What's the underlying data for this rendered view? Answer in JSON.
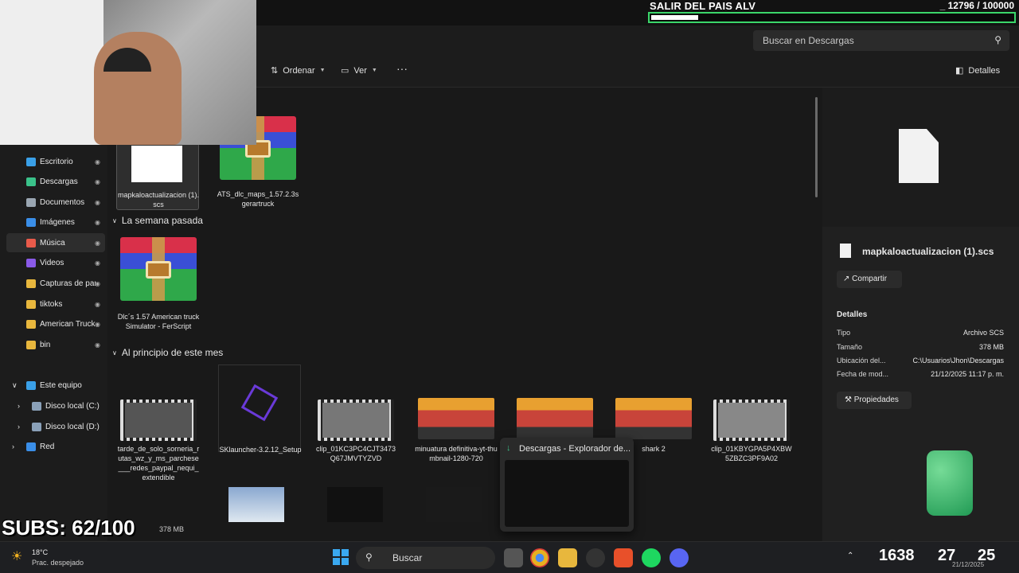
{
  "goal": {
    "title": "SALIR DEL PAIS ALV",
    "count": "_ 12796 / 100000",
    "progress": 0.128
  },
  "search": {
    "placeholder": "Buscar en Descargas"
  },
  "toolbar": {
    "sort": "Ordenar",
    "view": "Ver",
    "more": "···",
    "details": "Detalles"
  },
  "sidebar": {
    "quick": [
      {
        "label": "Escritorio",
        "icon": "desktop-icon",
        "color": "#3aa0e8"
      },
      {
        "label": "Descargas",
        "icon": "download-icon",
        "color": "#3ac28a"
      },
      {
        "label": "Documentos",
        "icon": "document-icon",
        "color": "#9aa6b2"
      },
      {
        "label": "Imágenes",
        "icon": "pictures-icon",
        "color": "#3a8ee8"
      },
      {
        "label": "Música",
        "icon": "music-icon",
        "color": "#e85a4a"
      },
      {
        "label": "Videos",
        "icon": "video-icon",
        "color": "#8a5ae8"
      },
      {
        "label": "Capturas de pan",
        "icon": "folder-icon",
        "color": "#e8b73d"
      },
      {
        "label": "tiktoks",
        "icon": "folder-icon",
        "color": "#e8b73d"
      },
      {
        "label": "American Truck",
        "icon": "folder-icon",
        "color": "#e8b73d"
      },
      {
        "label": "bin",
        "icon": "folder-icon",
        "color": "#e8b73d"
      }
    ],
    "tree": [
      {
        "label": "Este equipo"
      },
      {
        "label": "Disco local (C:)"
      },
      {
        "label": "Disco local (D:)"
      },
      {
        "label": "Red"
      }
    ]
  },
  "groups": {
    "last_week": "La semana pasada",
    "this_month": "Al principio de este mes"
  },
  "files": {
    "top": [
      {
        "name": "mapkaloactualizacion (1).scs"
      },
      {
        "name": "ATS_dlc_maps_1.57.2.3s gerartruck"
      }
    ],
    "week": [
      {
        "name": "Dlc´s 1.57 American truck Simulator - FerScript"
      }
    ],
    "month": [
      {
        "name": "tarde_de_solo_sorneria_rutas_wz_y_ms_parchese___redes_paypal_nequi_extendible"
      },
      {
        "name": "SKlauncher-3.2.12_Setup"
      },
      {
        "name": "clip_01KC3PC4CJT3473Q67JMVTYZVD"
      },
      {
        "name": "minuatura definitiva-yt-thumbnail-1280-720"
      },
      {
        "name": ""
      },
      {
        "name": "shark 2"
      },
      {
        "name": "clip_01KBYGPA5P4XBW5ZBZC3PF9A02"
      }
    ]
  },
  "details": {
    "file_name": "mapkaloactualizacion (1).scs",
    "share": "Compartir",
    "section": "Detalles",
    "rows": [
      {
        "k": "Tipo",
        "v": "Archivo SCS"
      },
      {
        "k": "Tamaño",
        "v": "378 MB"
      },
      {
        "k": "Ubicación del...",
        "v": "C:\\Usuarios\\Jhon\\Descargas"
      },
      {
        "k": "Fecha de mod...",
        "v": "21/12/2025 11:17 p. m."
      }
    ],
    "properties": "Propiedades"
  },
  "status": {
    "size": "378 MB"
  },
  "overlay": {
    "subs": "SUBS: 62/100"
  },
  "hover": {
    "title": "Descargas - Explorador de..."
  },
  "taskbar": {
    "search": "Buscar",
    "weather_temp": "18°C",
    "weather_text": "Prac. despejado",
    "clock": "1638",
    "timer_m": "27",
    "timer_s": "25",
    "date": "21/12/2025"
  }
}
